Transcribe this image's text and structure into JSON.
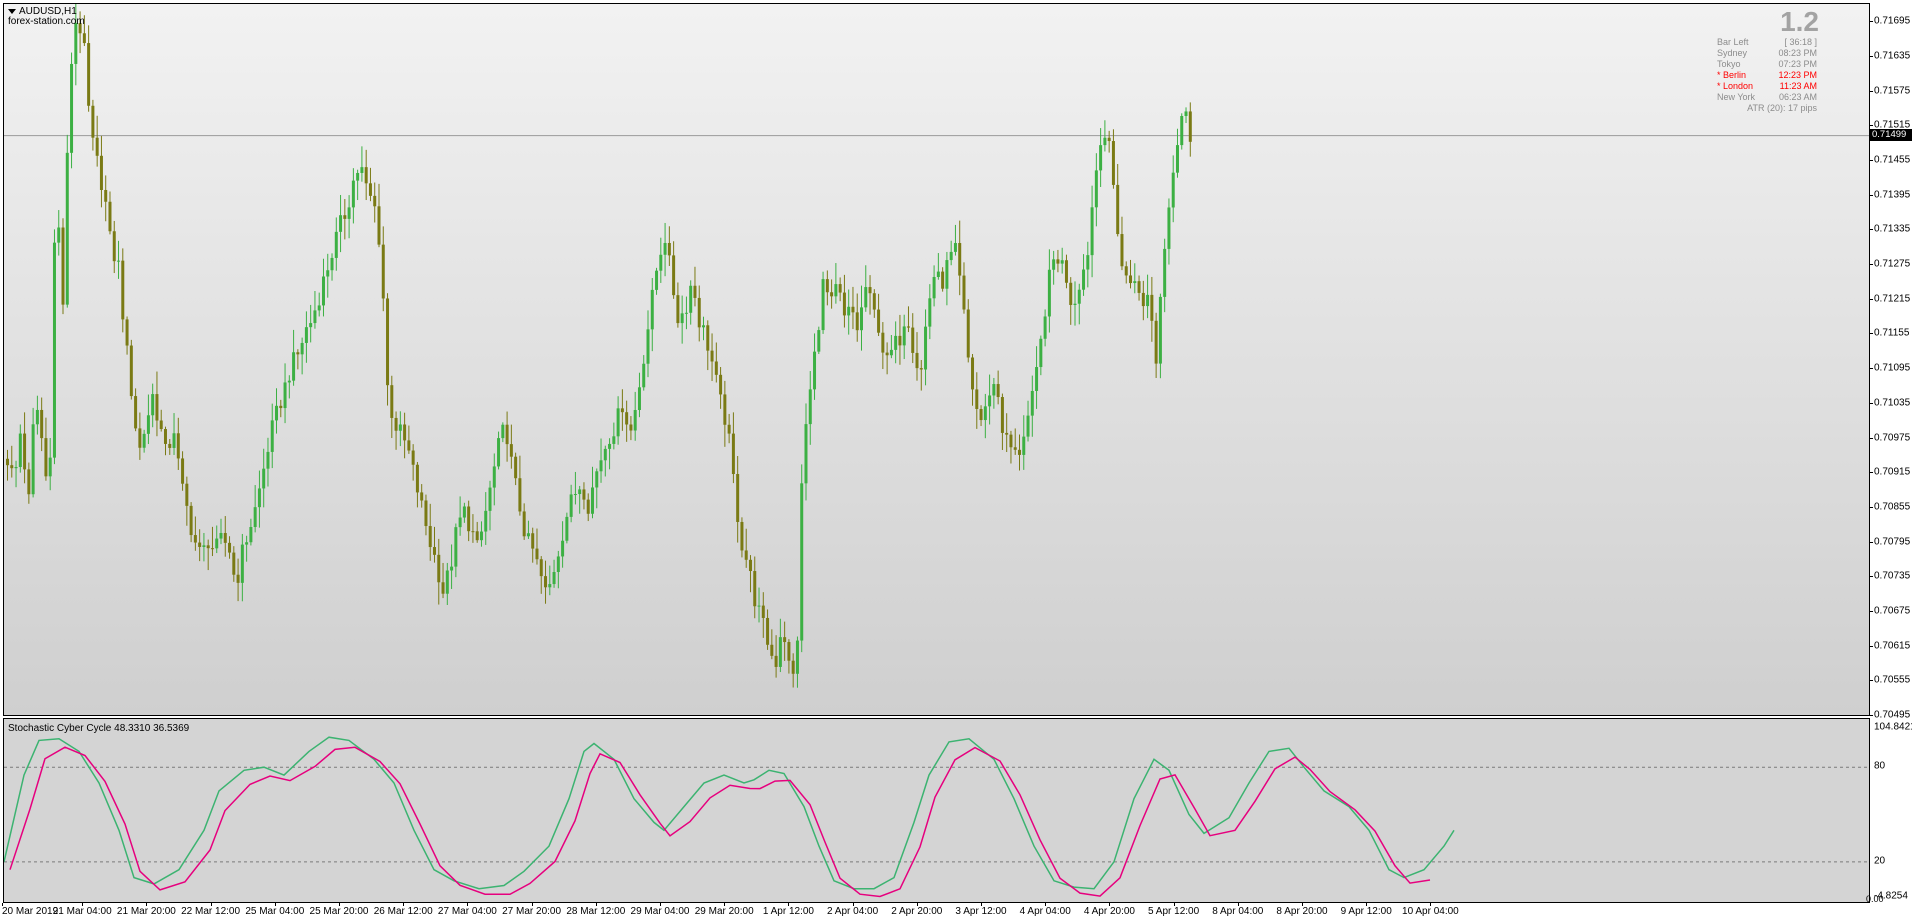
{
  "header": {
    "symbol": "AUDUSD,H1",
    "watermark": "forex-station.com",
    "version": "1.2"
  },
  "sessions": [
    {
      "label": "Bar Left",
      "value": "[ 36:18 ]",
      "active": false
    },
    {
      "label": "Sydney",
      "value": "08:23 PM",
      "active": false
    },
    {
      "label": "Tokyo",
      "value": "07:23 PM",
      "active": false
    },
    {
      "label": "* Berlin",
      "value": "12:23 PM",
      "active": true
    },
    {
      "label": "* London",
      "value": "11:23 AM",
      "active": true
    },
    {
      "label": "New York",
      "value": "06:23 AM",
      "active": false
    }
  ],
  "atr_text": "ATR (20): 17 pips",
  "current_price": "0.71499",
  "price_axis": {
    "labels": [
      "0.71695",
      "0.71635",
      "0.71575",
      "0.71515",
      "0.71455",
      "0.71395",
      "0.71335",
      "0.71275",
      "0.71215",
      "0.71155",
      "0.71095",
      "0.71035",
      "0.70975",
      "0.70915",
      "0.70855",
      "0.70795",
      "0.70735",
      "0.70675",
      "0.70615",
      "0.70555",
      "0.70495"
    ]
  },
  "indicator": {
    "title": "Stochastic Cyber Cycle 48.3310 36.5369",
    "axis_labels": {
      "top": "104.8421",
      "level_high": "80",
      "level_low": "20",
      "bottom_a": "-4.8254",
      "bottom_b": "0.00"
    },
    "fast_color": "#3cb371",
    "slow_color": "#e6007e"
  },
  "time_axis": {
    "labels": [
      "20 Mar 2019",
      "21 Mar 04:00",
      "21 Mar 20:00",
      "22 Mar 12:00",
      "25 Mar 04:00",
      "25 Mar 20:00",
      "26 Mar 12:00",
      "27 Mar 04:00",
      "27 Mar 20:00",
      "28 Mar 12:00",
      "29 Mar 04:00",
      "29 Mar 20:00",
      "1 Apr 12:00",
      "2 Apr 04:00",
      "2 Apr 20:00",
      "3 Apr 12:00",
      "4 Apr 04:00",
      "4 Apr 20:00",
      "5 Apr 12:00",
      "8 Apr 04:00",
      "8 Apr 20:00",
      "9 Apr 12:00",
      "10 Apr 04:00"
    ]
  },
  "colors": {
    "bull": "#3cb043",
    "bear": "#7a7a14",
    "price_line": "#9a9a9a"
  },
  "chart_data": {
    "type": "candlestick",
    "title": "AUDUSD,H1",
    "ylim": [
      0.70495,
      0.71725
    ],
    "path": [
      0.7094,
      0.709,
      0.71,
      0.7085,
      0.7105,
      0.7097,
      0.7086,
      0.7143,
      0.712,
      0.716,
      0.7171,
      0.7166,
      0.715,
      0.7145,
      0.714,
      0.713,
      0.7128,
      0.7115,
      0.7105,
      0.7095,
      0.71,
      0.7105,
      0.71,
      0.7094,
      0.71,
      0.709,
      0.7085,
      0.708,
      0.7077,
      0.708,
      0.7078,
      0.708,
      0.7079,
      0.7072,
      0.7078,
      0.7082,
      0.7086,
      0.7092,
      0.7098,
      0.7102,
      0.7106,
      0.711,
      0.7112,
      0.7116,
      0.7118,
      0.7122,
      0.7126,
      0.713,
      0.7134,
      0.7137,
      0.7142,
      0.7145,
      0.714,
      0.7138,
      0.713,
      0.7105,
      0.71,
      0.7098,
      0.7095,
      0.709,
      0.7085,
      0.708,
      0.7076,
      0.7071,
      0.7075,
      0.7082,
      0.7085,
      0.7082,
      0.7078,
      0.7084,
      0.709,
      0.7096,
      0.71,
      0.7092,
      0.7086,
      0.708,
      0.7078,
      0.7074,
      0.707,
      0.7075,
      0.708,
      0.7085,
      0.7088,
      0.709,
      0.7086,
      0.7091,
      0.7095,
      0.7098,
      0.71,
      0.7104,
      0.7098,
      0.7104,
      0.7112,
      0.712,
      0.7128,
      0.7133,
      0.7125,
      0.7118,
      0.712,
      0.7125,
      0.7118,
      0.7115,
      0.711,
      0.7104,
      0.71,
      0.709,
      0.708,
      0.7076,
      0.707,
      0.7066,
      0.7062,
      0.7058,
      0.7066,
      0.7058,
      0.7055,
      0.7096,
      0.7105,
      0.7115,
      0.7125,
      0.712,
      0.7124,
      0.7118,
      0.712,
      0.7116,
      0.7124,
      0.712,
      0.7117,
      0.711,
      0.7113,
      0.7115,
      0.712,
      0.7113,
      0.7108,
      0.712,
      0.7126,
      0.7124,
      0.7128,
      0.713,
      0.7122,
      0.711,
      0.7103,
      0.71,
      0.7106,
      0.7107,
      0.7098,
      0.7096,
      0.7094,
      0.7099,
      0.7103,
      0.711,
      0.712,
      0.7128,
      0.7129,
      0.7126,
      0.712,
      0.7125,
      0.7128,
      0.714,
      0.715,
      0.715,
      0.714,
      0.7128,
      0.7124,
      0.7126,
      0.7119,
      0.7124,
      0.711,
      0.7128,
      0.714,
      0.7148,
      0.7155,
      0.715
    ]
  }
}
